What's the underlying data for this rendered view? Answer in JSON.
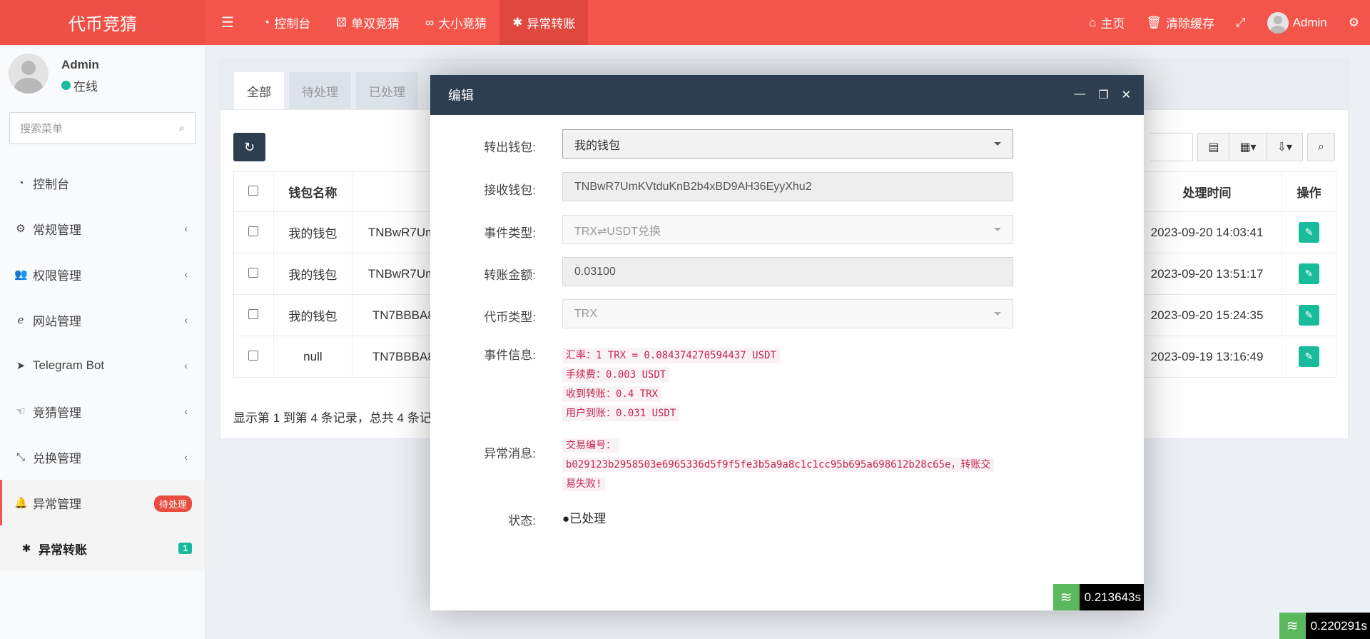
{
  "header": {
    "logo": "代币竞猜",
    "nav": [
      {
        "icon": "dashboard-icon",
        "label": "控制台"
      },
      {
        "icon": "dice-icon",
        "label": "单双竞猜"
      },
      {
        "icon": "size-icon",
        "label": "大小竞猜"
      },
      {
        "icon": "bug-icon",
        "label": "异常转账"
      }
    ],
    "right": {
      "home": "主页",
      "clear_cache": "清除缓存",
      "admin": "Admin"
    }
  },
  "sidebar": {
    "user": {
      "name": "Admin",
      "status": "在线"
    },
    "search_placeholder": "搜索菜单",
    "items": [
      {
        "label": "控制台",
        "icon": "dashboard-icon"
      },
      {
        "label": "常规管理",
        "icon": "cogs-icon"
      },
      {
        "label": "权限管理",
        "icon": "group-icon"
      },
      {
        "label": "网站管理",
        "icon": "ie-icon"
      },
      {
        "label": "Telegram Bot",
        "icon": "telegram-icon"
      },
      {
        "label": "竞猜管理",
        "icon": "hand-icon"
      },
      {
        "label": "兑换管理",
        "icon": "exchange-icon"
      },
      {
        "label": "异常管理",
        "icon": "bell-icon",
        "badge": "待处理"
      }
    ],
    "sub_item": {
      "label": "异常转账",
      "badge": "1"
    }
  },
  "content": {
    "tabs": [
      "全部",
      "待处理",
      "已处理"
    ],
    "table": {
      "headers": {
        "name": "钱包名称",
        "time": "处理时间",
        "action": "操作"
      },
      "rows": [
        {
          "name": "我的钱包",
          "addr": "TNBwR7Um",
          "time": "2023-09-20 14:03:41"
        },
        {
          "name": "我的钱包",
          "addr": "TNBwR7Um",
          "time": "2023-09-20 13:51:17"
        },
        {
          "name": "我的钱包",
          "addr": "TN7BBBA8",
          "time": "2023-09-20 15:24:35"
        },
        {
          "name": "null",
          "addr": "TN7BBBA8",
          "time": "2023-09-19 13:16:49"
        }
      ]
    },
    "footer": "显示第 1 到第 4 条记录，总共 4 条记"
  },
  "modal": {
    "title": "编辑",
    "fields": {
      "from_wallet": {
        "label": "转出钱包:",
        "value": "我的钱包"
      },
      "to_wallet": {
        "label": "接收钱包:",
        "value": "TNBwR7UmKVtduKnB2b4xBD9AH36EyyXhu2"
      },
      "event_type": {
        "label": "事件类型:",
        "value": "TRX⇌USDT兑换"
      },
      "amount": {
        "label": "转账金额:",
        "value": "0.03100"
      },
      "token_type": {
        "label": "代币类型:",
        "value": "TRX"
      },
      "event_info": {
        "label": "事件信息:",
        "lines": [
          "汇率：1 TRX = 0.084374270594437 USDT",
          "手续费：0.003 USDT",
          "收到转账：0.4 TRX",
          "用户到账：0.031 USDT"
        ]
      },
      "error_msg": {
        "label": "异常消息:",
        "line1": "交易编号：",
        "line2": "b029123b2958503e6965336d5f9f5fe3b5a9a8c1c1cc95b695a698612b28c65e，转账交",
        "line3": "易失败!"
      },
      "status": {
        "label": "状态:",
        "value": "●已处理"
      }
    },
    "timer": "0.213643s"
  },
  "page_timer": "0.220291s"
}
